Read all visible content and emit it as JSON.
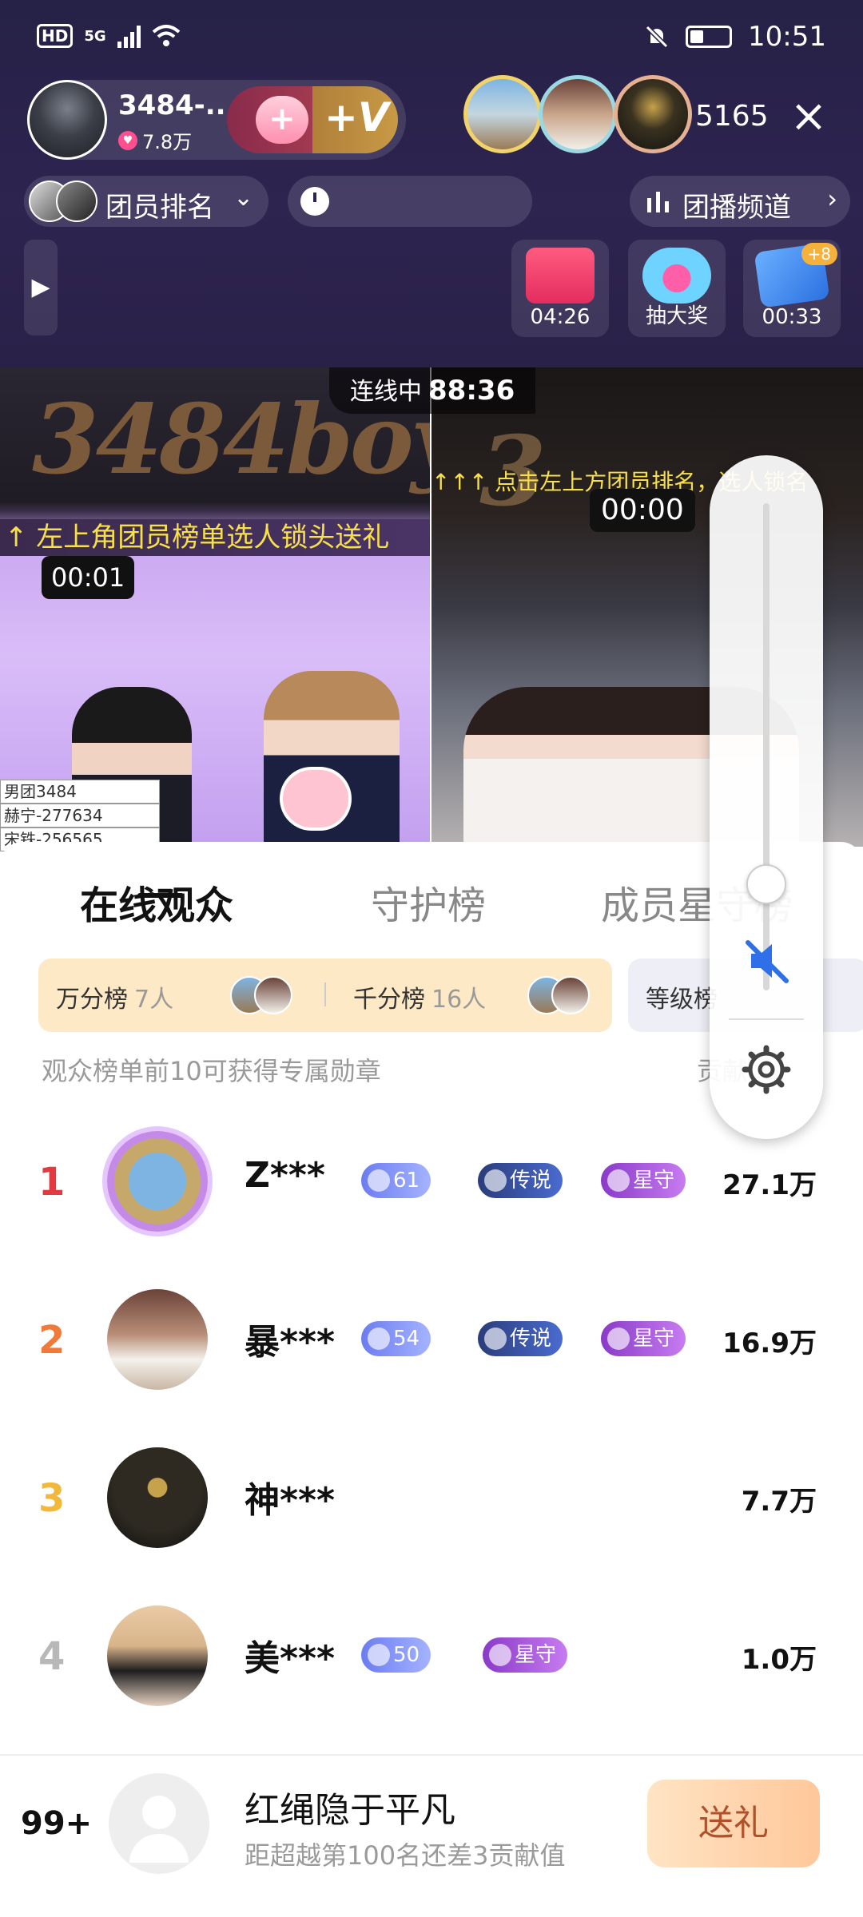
{
  "status_bar": {
    "left": "HD",
    "network": "5G",
    "time": "10:51"
  },
  "host": {
    "name": "3484-...",
    "likes": "7.8万",
    "join_plus": "+",
    "join_v": "+V"
  },
  "viewer_count": "5165",
  "controls": {
    "team_rank_label": "团员排名",
    "channel_label": "团播频道"
  },
  "activities": [
    {
      "label": "04:26"
    },
    {
      "label": "抽大奖"
    },
    {
      "label": "00:33",
      "plus": "+8"
    }
  ],
  "video": {
    "logo": "3484boy",
    "link_label": "连线中",
    "link_time": "88:36",
    "marquee_left": "↑ 左上角团员榜单选人锁头送礼",
    "marquee_right": "↑↑↑ 点击左上方团员排名，选人锁名",
    "timer_left": "00:01",
    "timer_right": "00:00",
    "name_table": [
      "男团3484",
      "赫宁-277634",
      "宋铁-256565"
    ]
  },
  "tabs": [
    "在线观众",
    "守护榜",
    "成员星守榜"
  ],
  "score_bar": {
    "wan_label": "万分榜",
    "wan_count": "7人",
    "qian_label": "千分榜",
    "qian_count": "16人",
    "level_label": "等级榜"
  },
  "hint": "观众榜单前10可获得专属勋章",
  "hint_right": "贡献",
  "ranking": [
    {
      "rank": "1",
      "name": "Z***",
      "level": "61",
      "legend": "传说",
      "star": "星守",
      "score": "27.1万"
    },
    {
      "rank": "2",
      "name": "暴***",
      "level": "54",
      "legend": "传说",
      "star": "星守",
      "score": "16.9万"
    },
    {
      "rank": "3",
      "name": "神***",
      "score": "7.7万"
    },
    {
      "rank": "4",
      "name": "美***",
      "level": "50",
      "star": "星守",
      "score": "1.0万"
    }
  ],
  "me": {
    "rank": "99+",
    "name": "红绳隐于平凡",
    "sub": "距超越第100名还差3贡献值",
    "gift_button": "送礼"
  },
  "colors": {
    "rank1": "#e33a3f",
    "rank2": "#ef7a3a",
    "rank3": "#f1b83c",
    "rank4": "#b8b8b8"
  }
}
